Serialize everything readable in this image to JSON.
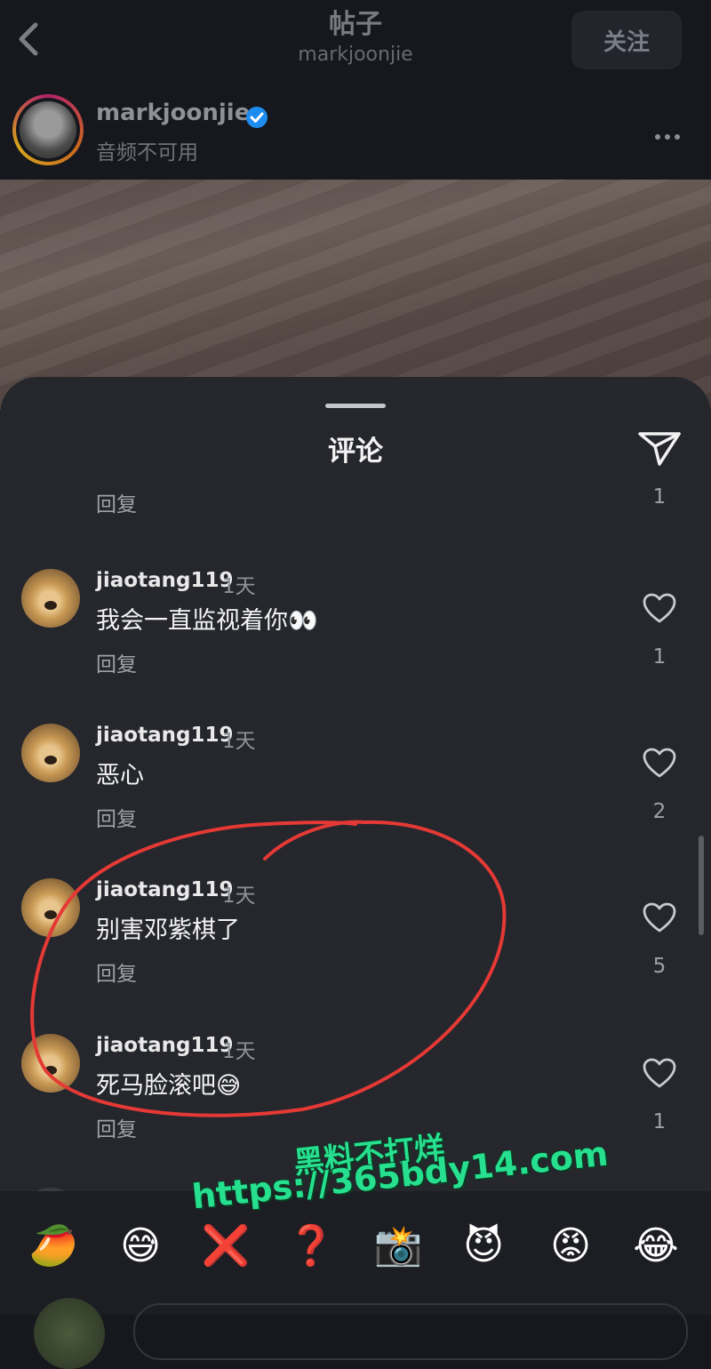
{
  "nav": {
    "title": "帖子",
    "subtitle": "markjoonjie",
    "follow_label": "关注"
  },
  "author": {
    "name": "markjoonjie",
    "note": "音频不可用"
  },
  "sheet": {
    "title": "评论",
    "top_reply_label": "回复",
    "top_reply_count": "1"
  },
  "comments": [
    {
      "user": "jiaotang119",
      "time": "1天",
      "text": "我会一直监视着你👀",
      "reply": "回复",
      "likes": "1"
    },
    {
      "user": "jiaotang119",
      "time": "1天",
      "text": "恶心",
      "reply": "回复",
      "likes": "2"
    },
    {
      "user": "jiaotang119",
      "time": "1天",
      "text": "别害邓紫棋了",
      "reply": "回复",
      "likes": "5"
    },
    {
      "user": "jiaotang119",
      "time": "1天",
      "text": "死马脸滚吧😅",
      "reply": "回复",
      "likes": "1"
    }
  ],
  "emoji_bar": [
    "🥭",
    "😅",
    "❌",
    "❓",
    "📸",
    "😈",
    "😡",
    "😂"
  ],
  "watermark": {
    "line1": "黑料不打烊",
    "line2": "https://365bdy14.com"
  },
  "colors": {
    "annotation": "#e53935",
    "watermark": "#27e08f",
    "verified": "#1d8cf0"
  }
}
